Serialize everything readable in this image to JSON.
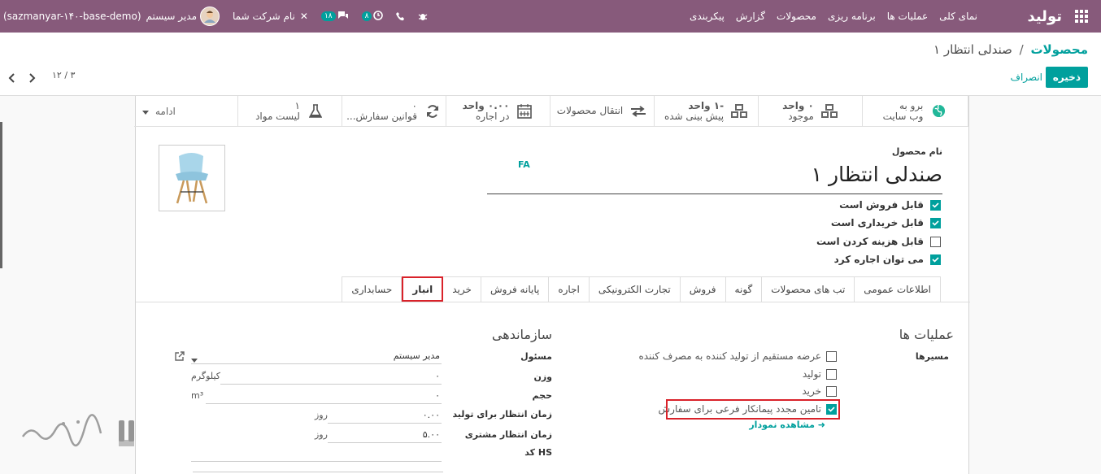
{
  "topbar": {
    "brand": "تولید",
    "menu": [
      "نمای کلی",
      "عملیات ها",
      "برنامه ریزی",
      "محصولات",
      "گزارش",
      "پیکربندی"
    ],
    "company": "نام شرکت شما",
    "messages_count": "۱۸",
    "activities_count": "۸",
    "user": "مدیر سیستم",
    "database": "(sazmanyar-۱۴۰-base-demo)",
    "accent": "#875a7b"
  },
  "breadcrumb": {
    "parent": "محصولات",
    "sep": "/",
    "current": "صندلی انتظار ۱"
  },
  "actions": {
    "save": "ذخیره",
    "discard": "انصراف"
  },
  "pager": {
    "value": "۱۲ / ۳"
  },
  "smart_buttons": [
    {
      "value": "برو به",
      "label": "وب سایت",
      "icon": "globe-icon"
    },
    {
      "value": "۰ واحد",
      "label": "موجود",
      "icon": "cubes-icon"
    },
    {
      "value": "-۱ واحد",
      "label": "پیش بینی شده",
      "icon": "cubes-icon"
    },
    {
      "value": "",
      "label": "انتقال محصولات",
      "icon": "exchange-icon"
    },
    {
      "value": "۰.۰۰ واحد",
      "label": "در اجاره",
      "icon": "calendar-icon"
    },
    {
      "value": "۰",
      "label": "قوانین سفارش...",
      "icon": "refresh-icon"
    },
    {
      "value": "۱",
      "label": "لیست مواد",
      "icon": "flask-icon"
    },
    {
      "value": "",
      "label": "ادامه",
      "icon": "caret-down-icon"
    }
  ],
  "product": {
    "name_label": "نام محصول",
    "name": "صندلی انتظار ۱",
    "lang": "FA",
    "flags": [
      {
        "label": "قابل فروش است",
        "checked": true
      },
      {
        "label": "قابل خریداری است",
        "checked": true
      },
      {
        "label": "قابل هزینه کردن است",
        "checked": false
      },
      {
        "label": "می توان اجاره کرد",
        "checked": true
      }
    ]
  },
  "tabs": [
    "اطلاعات عمومی",
    "تب های محصولات",
    "گونه",
    "فروش",
    "تجارت الکترونیکی",
    "اجاره",
    "پایانه فروش",
    "خرید",
    "انبار",
    "حسابداری"
  ],
  "active_tab": "انبار",
  "operations": {
    "title": "عملیات ها",
    "routes_label": "مسیرها",
    "routes": [
      {
        "label": "عرضه مستقیم از تولید کننده به مصرف کننده",
        "checked": false
      },
      {
        "label": "تولید",
        "checked": false
      },
      {
        "label": "خرید",
        "checked": false
      },
      {
        "label": "تامین مجدد پیمانکار فرعی برای سفارش",
        "checked": true
      }
    ],
    "diagram_link": "مشاهده نمودار"
  },
  "organization": {
    "title": "سازماندهی",
    "fields": [
      {
        "label": "مسئول",
        "value": "مدیر سیستم",
        "unit": ""
      },
      {
        "label": "وزن",
        "value": "۰",
        "unit": "کیلوگرم"
      },
      {
        "label": "حجم",
        "value": "۰",
        "unit": "m³"
      },
      {
        "label": "زمان انتظار برای تولید",
        "value": "۰.۰۰",
        "unit": "روز"
      },
      {
        "label": "زمان انتظار مشتری",
        "value": "۵.۰۰",
        "unit": "روز"
      },
      {
        "label": "کد HS",
        "value": "",
        "unit": ""
      }
    ]
  }
}
